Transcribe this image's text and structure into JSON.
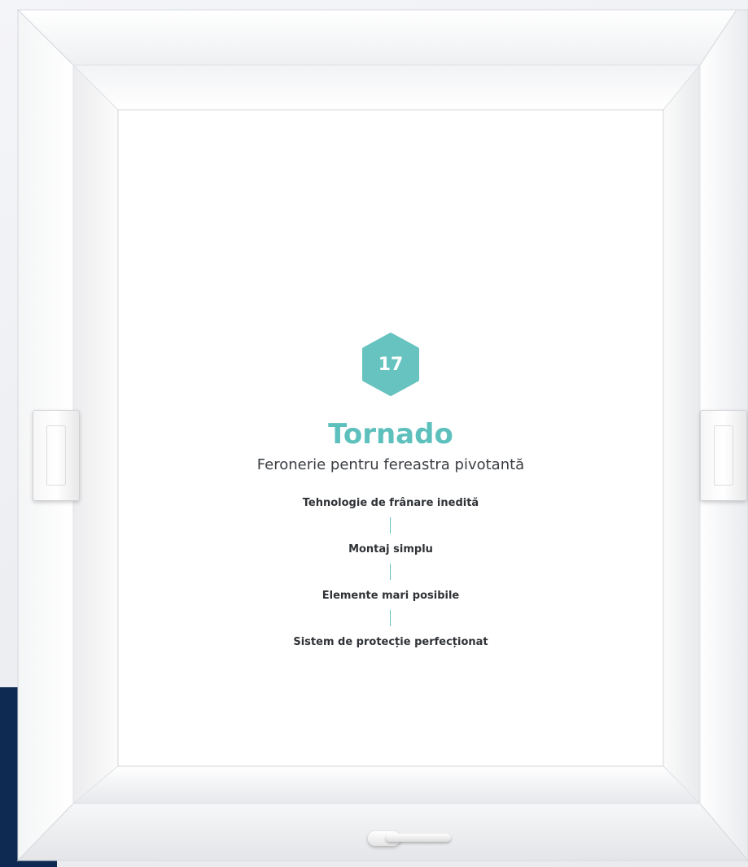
{
  "badge": {
    "number": "17",
    "color": "#67c3c0"
  },
  "product": {
    "title": "Tornado",
    "subtitle": "Feronerie pentru fereastra pivotantă"
  },
  "features": [
    "Tehnologie de frânare inedită",
    "Montaj simplu",
    "Elemente mari posibile",
    "Sistem de protecție perfecționat"
  ],
  "colors": {
    "accent": "#5ec0bd",
    "text": "#2f3236",
    "background_dark": "#0f2a52"
  }
}
